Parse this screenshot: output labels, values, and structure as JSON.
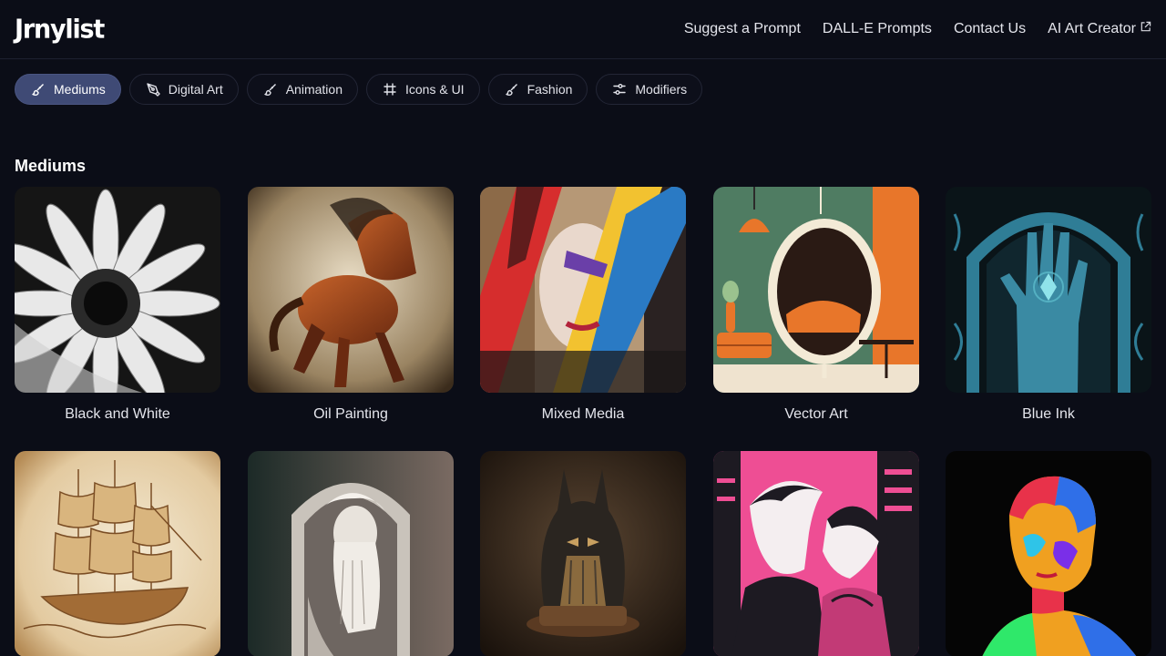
{
  "brand": {
    "logo": "Jrnylist"
  },
  "nav": {
    "items": [
      {
        "label": "Suggest a Prompt"
      },
      {
        "label": "DALL-E Prompts"
      },
      {
        "label": "Contact Us"
      },
      {
        "label": "AI Art Creator"
      }
    ]
  },
  "tabs": [
    {
      "label": "Mediums",
      "icon": "brush-icon",
      "active": true
    },
    {
      "label": "Digital Art",
      "icon": "pen-tool-icon",
      "active": false
    },
    {
      "label": "Animation",
      "icon": "brush-icon",
      "active": false
    },
    {
      "label": "Icons & UI",
      "icon": "frame-icon",
      "active": false
    },
    {
      "label": "Fashion",
      "icon": "brush-icon",
      "active": false
    },
    {
      "label": "Modifiers",
      "icon": "sliders-icon",
      "active": false
    }
  ],
  "section": {
    "title": "Mediums"
  },
  "cards": [
    {
      "label": "Black and White"
    },
    {
      "label": "Oil Painting"
    },
    {
      "label": "Mixed Media"
    },
    {
      "label": "Vector Art"
    },
    {
      "label": "Blue Ink"
    },
    {
      "label": ""
    },
    {
      "label": ""
    },
    {
      "label": ""
    },
    {
      "label": ""
    },
    {
      "label": ""
    }
  ],
  "colors": {
    "background": "#0b0d17",
    "active_tab": "#3f4a75"
  }
}
